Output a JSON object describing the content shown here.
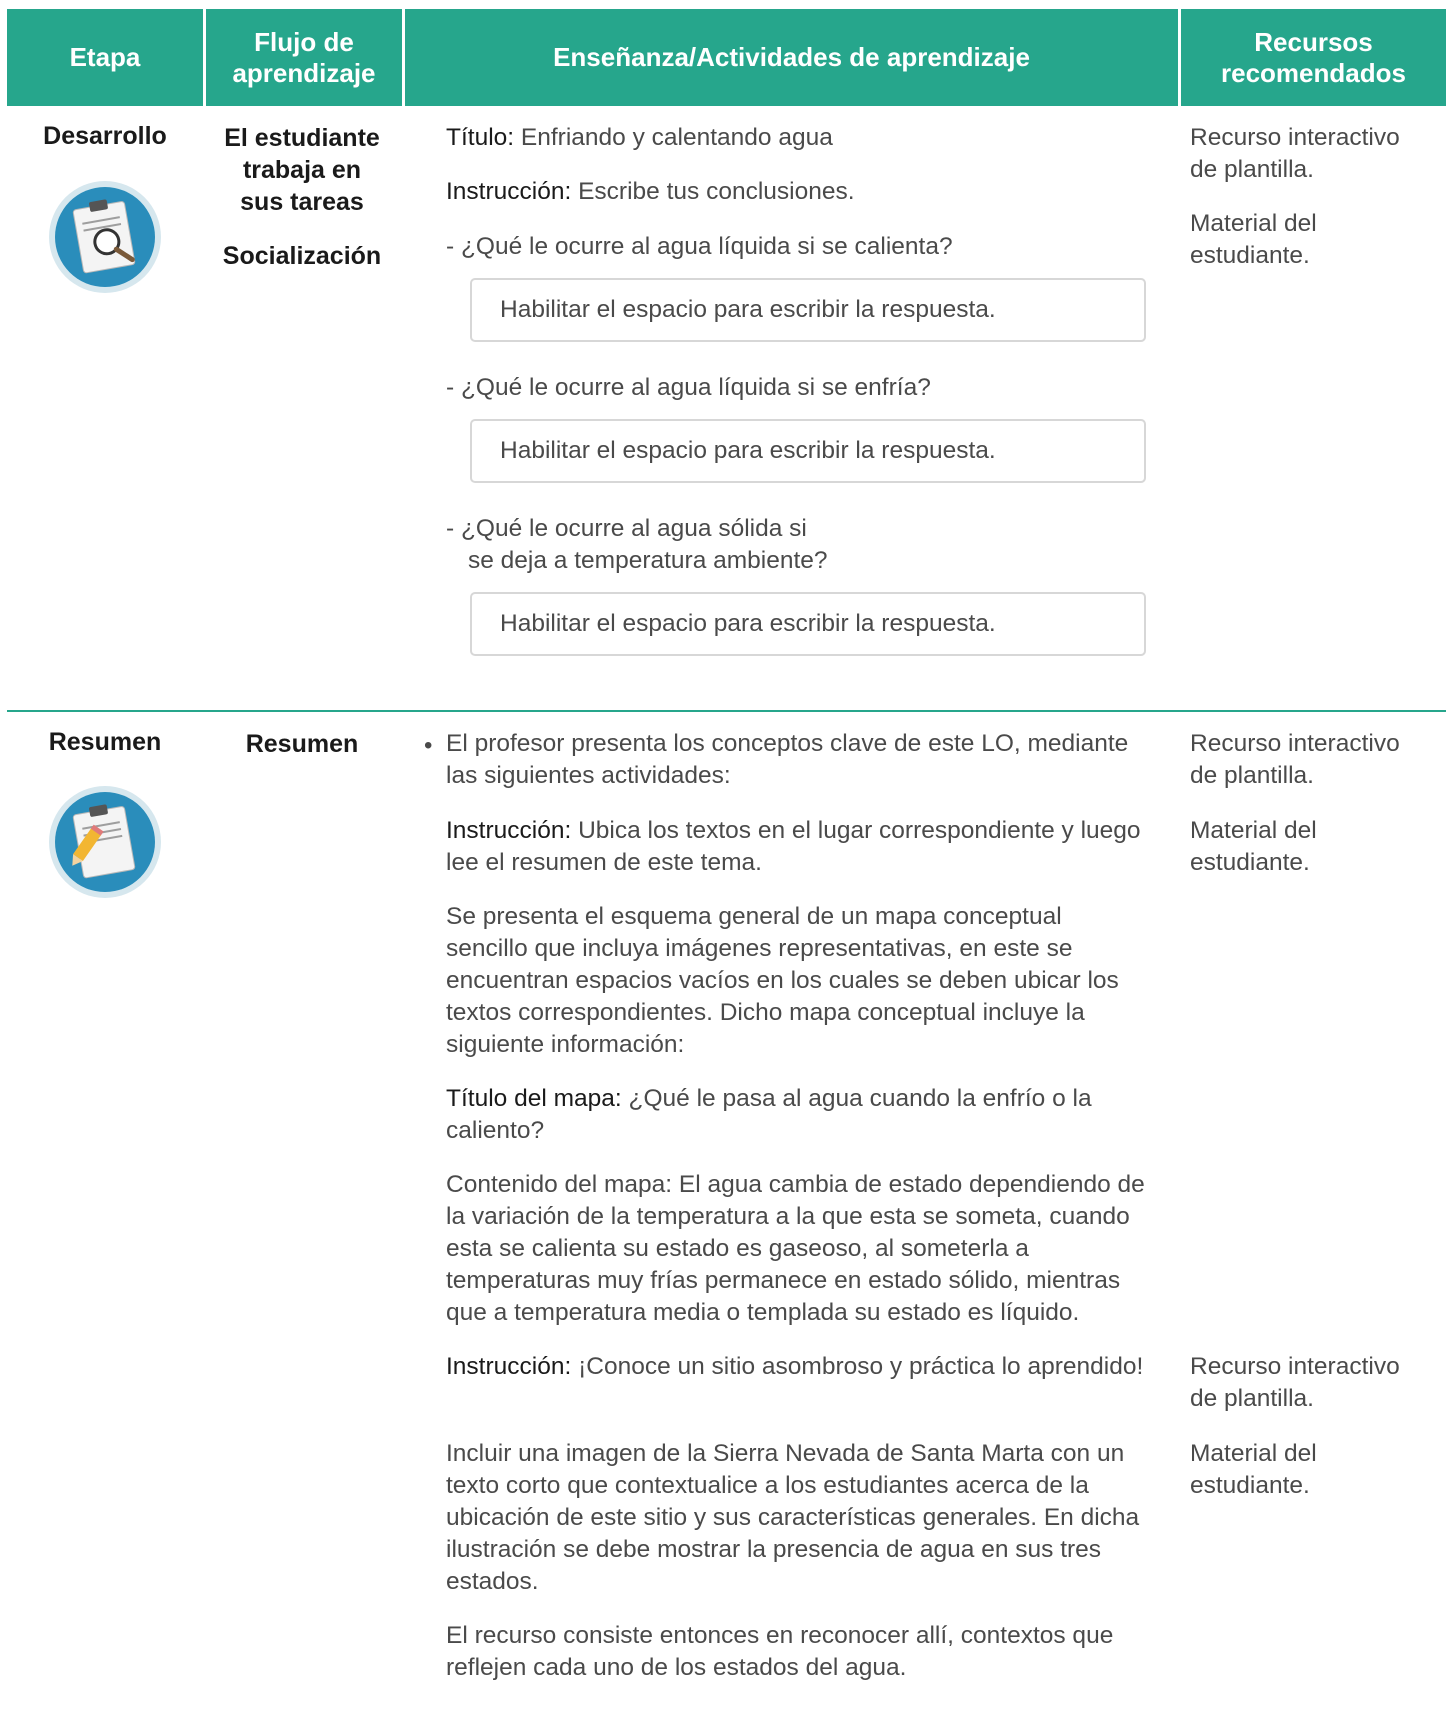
{
  "header": {
    "etapa": "Etapa",
    "flujo": "Flujo de aprendizaje",
    "ensenanza": "Enseñanza/Actividades de aprendizaje",
    "recursos": "Recursos recomendados",
    "color": "#26a68c"
  },
  "desarrollo": {
    "etapa": "Desarrollo",
    "icon": "clipboard-magnifier-icon",
    "flujo": [
      "El estudiante",
      "trabaja en",
      "sus tareas"
    ],
    "flujo2": "Socialización",
    "titulo_label": "Título:",
    "titulo_text": " Enfriando y calentando agua",
    "instr_label": "Instrucción:",
    "instr_text": " Escribe tus conclusiones.",
    "q1": "- ¿Qué le ocurre al agua líquida si se calienta?",
    "q2": "- ¿Qué le ocurre al agua líquida si se enfría?",
    "q3_line1": "- ¿Qué le ocurre al agua sólida si",
    "q3_line2": "se deja a temperatura ambiente?",
    "answer_placeholder": "Habilitar el espacio para escribir la respuesta.",
    "recursos": [
      "Recurso interactivo de plantilla.",
      "Material del estudiante."
    ]
  },
  "resumen": {
    "etapa": "Resumen",
    "icon": "clipboard-pencil-icon",
    "flujo": "Resumen",
    "p1": "El profesor presenta los conceptos clave de este LO, mediante las siguientes actividades:",
    "instr1_label": "Instrucción:",
    "instr1_text": " Ubica los textos en el lugar correspondiente y luego lee el resumen de este tema.",
    "p2": "Se presenta el esquema general de un mapa conceptual sencillo que incluya imágenes representativas, en este se encuentran espacios vacíos en los cuales se deben ubicar los textos correspondientes. Dicho mapa conceptual incluye la siguiente información:",
    "titulo_mapa_label": "Título del mapa:",
    "titulo_mapa_text": " ¿Qué le pasa al agua cuando la enfrío o la caliento?",
    "p3": "Contenido del mapa: El agua cambia de estado dependiendo de la variación de la temperatura a la que esta se someta, cuando esta se calienta su estado es gaseoso, al someterla a temperaturas muy frías permanece en estado sólido, mientras que a temperatura media o templada su estado es líquido.",
    "instr2_label": "Instrucción:",
    "instr2_text": " ¡Conoce un sitio asombroso y práctica lo aprendido!",
    "p4": "Incluir una imagen de la Sierra Nevada de Santa Marta con un texto corto que contextualice a los estudiantes acerca de la ubicación de este sitio y sus características generales. En dicha ilustración se debe mostrar la presencia de agua en sus tres estados.",
    "p5": "El recurso consiste entonces en reconocer allí, contextos que reflejen cada uno de los estados del agua.",
    "recursos1": [
      "Recurso interactivo de plantilla.",
      "Material del estudiante."
    ],
    "recursos2": [
      "Recurso interactivo de plantilla.",
      "Material del estudiante."
    ]
  }
}
